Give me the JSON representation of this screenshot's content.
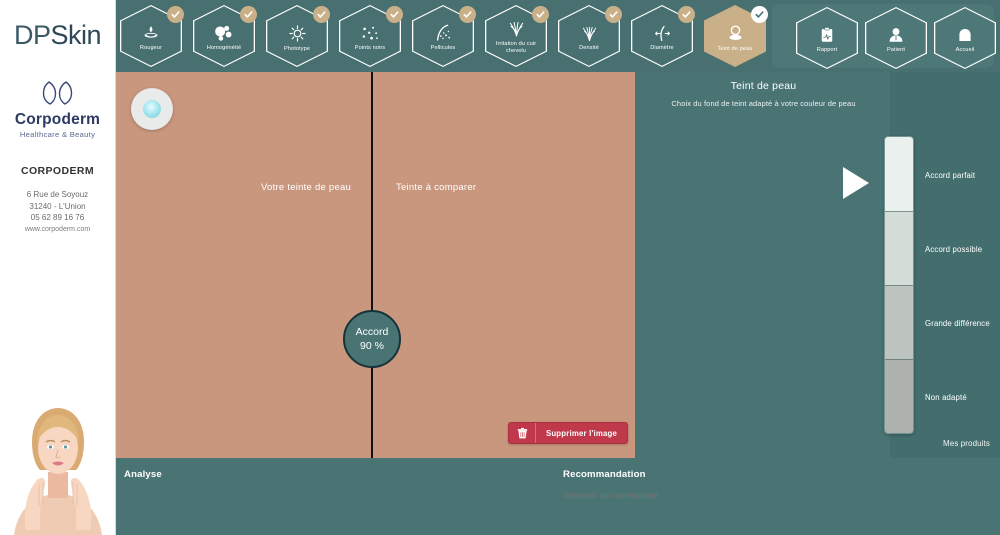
{
  "sidebar": {
    "app_title_prefix": "DP",
    "app_title_suffix": "Skin",
    "brand_name": "Corpoderm",
    "brand_tagline": "Healthcare & Beauty",
    "clinic_name": "CORPODERM",
    "address_line1": "6 Rue de Soyouz",
    "address_line2": "31240  -  L'Union",
    "phone": "05 62 89 16 76",
    "website": "www.corpoderm.com",
    "photo_alt": "woman-face-photo"
  },
  "topnav": {
    "tabs": [
      {
        "label": "Rougeur",
        "icon": "flame-icon",
        "checked": true,
        "active": false
      },
      {
        "label": "Homogénéité",
        "icon": "blobs-icon",
        "checked": true,
        "active": false
      },
      {
        "label": "Phototype",
        "icon": "sun-icon",
        "checked": true,
        "active": false
      },
      {
        "label": "Points noirs",
        "icon": "dots-icon",
        "checked": true,
        "active": false
      },
      {
        "label": "Pellicules",
        "icon": "flakes-icon",
        "checked": true,
        "active": false
      },
      {
        "label": "Irritation du cuir chevelu",
        "icon": "scalp-icon",
        "checked": true,
        "active": false
      },
      {
        "label": "Densité",
        "icon": "density-icon",
        "checked": true,
        "active": false
      },
      {
        "label": "Diamètre",
        "icon": "diameter-icon",
        "checked": true,
        "active": false
      },
      {
        "label": "Teint de peau",
        "icon": "compact-powder-icon",
        "checked": true,
        "active": true
      }
    ],
    "right_tabs": [
      {
        "label": "Rapport",
        "icon": "clipboard-report-icon"
      },
      {
        "label": "Patient",
        "icon": "user-icon"
      },
      {
        "label": "Accueil",
        "icon": "home-icon"
      }
    ]
  },
  "main": {
    "light_toggle": "light-bulb-toggle",
    "label_your_tone": "Votre teinte de peau",
    "label_compare_tone": "Teinte à comparer",
    "accord_title": "Accord",
    "accord_value": "90 %",
    "delete_button": "Supprimer l'image",
    "skin_color_left": "#c9967e",
    "skin_color_right": "#c9967e"
  },
  "panel": {
    "title": "Teint de peau",
    "subtitle": "Choix du fond de teint adapté à votre couleur de peau",
    "scale": [
      {
        "label": "Accord parfait",
        "color": "#e9f0ed"
      },
      {
        "label": "Accord possible",
        "color": "#d4dcd8"
      },
      {
        "label": "Grande différence",
        "color": "#bdc4bf"
      },
      {
        "label": "Non adapté",
        "color": "#adb2ad"
      }
    ],
    "marker": "selection-marker-triangle",
    "my_products": "Mes produits"
  },
  "bottom": {
    "analyse_title": "Analyse",
    "recommendation_title": "Recommandation",
    "recommendation_value": "",
    "recommendation_placeholder": "Saisissez un commentaire"
  },
  "colors": {
    "teal": "#4a7474",
    "teal_dark": "#487070",
    "tan": "#c9b089",
    "red": "#c0394b",
    "navy": "#2d3a62"
  }
}
